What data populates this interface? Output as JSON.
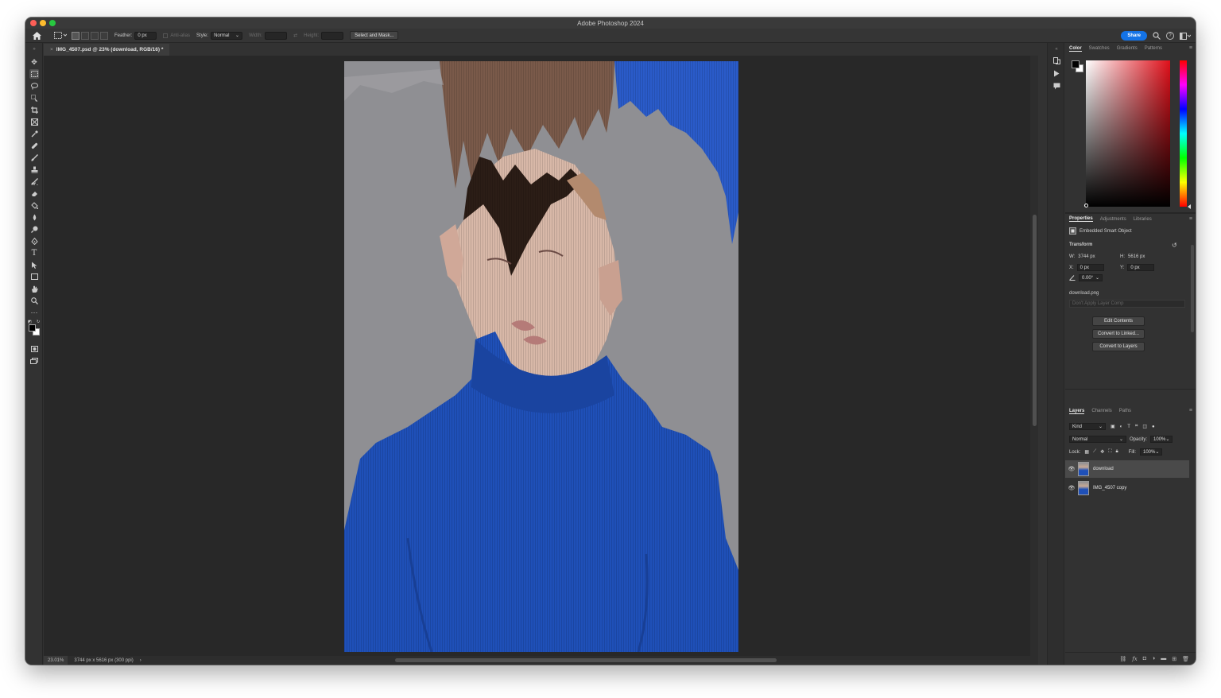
{
  "app": {
    "title": "Adobe Photoshop 2024"
  },
  "options": {
    "feather_label": "Feather:",
    "feather_value": "0 px",
    "anti_alias_label": "Anti-alias",
    "style_label": "Style:",
    "style_value": "Normal",
    "width_label": "Width:",
    "height_label": "Height:",
    "select_mask_label": "Select and Mask...",
    "share_label": "Share"
  },
  "document": {
    "tab_title": "IMG_4507.psd @ 23% (download, RGB/16) *",
    "tab_close": "×"
  },
  "status": {
    "zoom": "23.01%",
    "doc_info": "3744 px x 5616 px (300 ppi)",
    "arrow": "›"
  },
  "tools": [
    "move-tool",
    "rectangular-marquee-tool",
    "lasso-tool",
    "object-selection-tool",
    "crop-tool",
    "frame-tool",
    "eyedropper-tool",
    "spot-healing-tool",
    "brush-tool",
    "clone-stamp-tool",
    "history-brush-tool",
    "eraser-tool",
    "paint-bucket-tool",
    "blur-tool",
    "dodge-tool",
    "pen-tool",
    "type-tool",
    "path-selection-tool",
    "rectangle-tool",
    "hand-tool",
    "zoom-tool",
    "edit-toolbar"
  ],
  "color_panel": {
    "tabs": [
      "Color",
      "Swatches",
      "Gradients",
      "Patterns"
    ],
    "foreground": "#000000",
    "background": "#ffffff",
    "hue_color": "#e0101a"
  },
  "properties_panel": {
    "tabs": [
      "Properties",
      "Adjustments",
      "Libraries"
    ],
    "object_type": "Embedded Smart Object",
    "transform_label": "Transform",
    "w_label": "W:",
    "w_value": "3744 px",
    "h_label": "H:",
    "h_value": "5616 px",
    "x_label": "X:",
    "x_value": "0 px",
    "y_label": "Y:",
    "y_value": "0 px",
    "angle_value": "0.00°",
    "file_name": "download.png",
    "layer_comp_placeholder": "Don't Apply Layer Comp",
    "edit_contents": "Edit Contents",
    "convert_linked": "Convert to Linked...",
    "convert_layers": "Convert to Layers"
  },
  "layers_panel": {
    "tabs": [
      "Layers",
      "Channels",
      "Paths"
    ],
    "filter_kind": "Kind",
    "blend_mode": "Normal",
    "opacity_label": "Opacity:",
    "opacity_value": "100%",
    "lock_label": "Lock:",
    "fill_label": "Fill:",
    "fill_value": "100%",
    "layers": [
      {
        "name": "download",
        "visible": true,
        "selected": true
      },
      {
        "name": "IMG_4507 copy",
        "visible": true,
        "selected": false
      }
    ]
  },
  "colors": {
    "accent": "#1473e6",
    "sweater_blue": "#1f50b8",
    "backdrop_grey": "#8f8f93"
  }
}
